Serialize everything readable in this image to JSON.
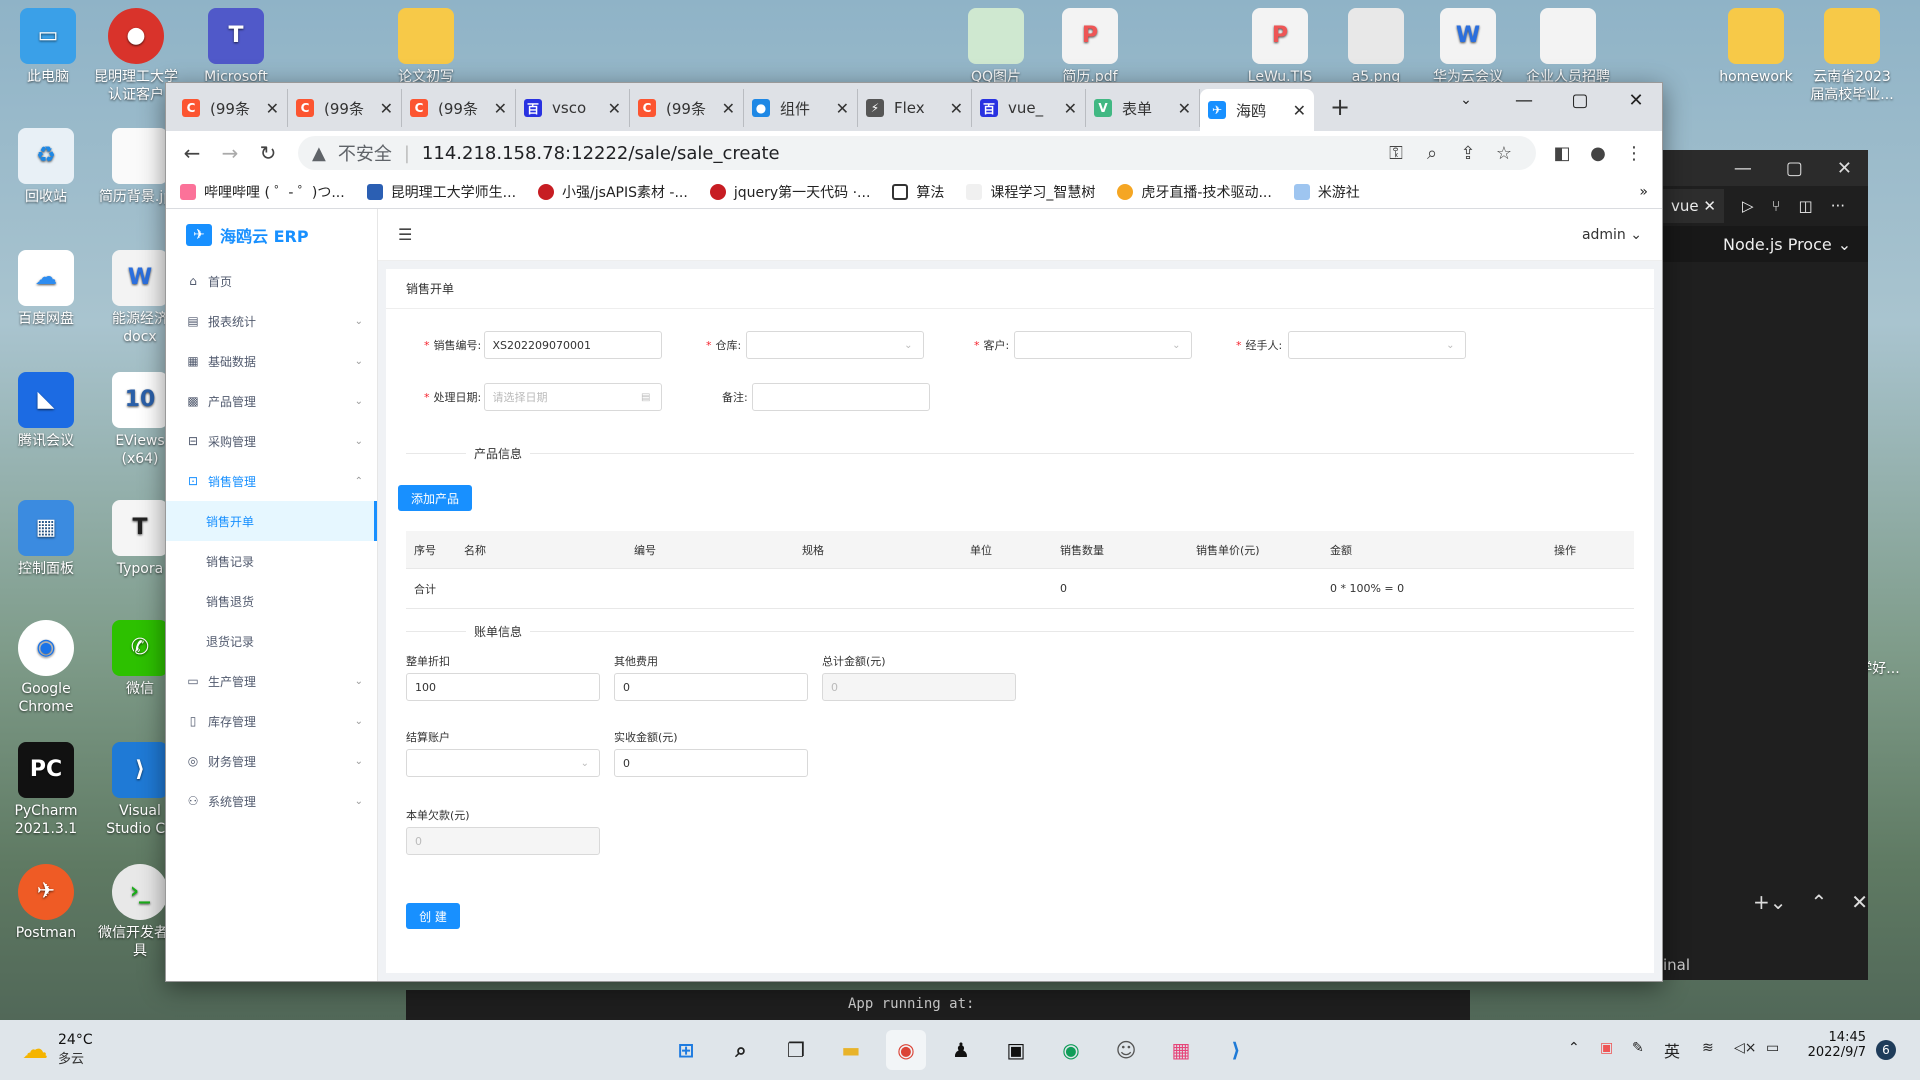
{
  "desktop": {
    "icons": [
      "此电脑",
      "昆明理工大学认证客户",
      "Microsoft",
      "论文初写",
      "QQ图片",
      "简历.pdf",
      "LeWu.TIS",
      "a5.png",
      "华为云会议",
      "企业人员招聘",
      "homework",
      "云南省2023届高校毕业...",
      "回收站",
      "简历背景.jpg",
      "百度网盘",
      "能源经济docx",
      "腾讯会议",
      "EViews (x64)",
      "控制面板",
      "Typora",
      "Google Chrome",
      "微信",
      "PyCharm 2021.3.1",
      "Visual Studio Co",
      "Postman",
      "微信开发者工具",
      "济学好..."
    ]
  },
  "browser": {
    "tabs": [
      {
        "title": "(99条",
        "color": "#fc5531",
        "glyph": "C"
      },
      {
        "title": "(99条",
        "color": "#fc5531",
        "glyph": "C"
      },
      {
        "title": "(99条",
        "color": "#fc5531",
        "glyph": "C"
      },
      {
        "title": "vsco",
        "color": "#2932e1",
        "glyph": "百"
      },
      {
        "title": "(99条",
        "color": "#fc5531",
        "glyph": "C"
      },
      {
        "title": "组件",
        "color": "#1e88e5",
        "glyph": "●"
      },
      {
        "title": "Flex",
        "color": "#555555",
        "glyph": "⚡"
      },
      {
        "title": "vue_",
        "color": "#2932e1",
        "glyph": "百"
      },
      {
        "title": "表单",
        "color": "#41b883",
        "glyph": "V"
      },
      {
        "title": "海鸥",
        "color": "#1890ff",
        "glyph": "✈"
      }
    ],
    "new_tab": "+",
    "security_label": "不安全",
    "url": "114.218.158.78:12222/sale/sale_create",
    "bookmarks": [
      "哔哩哔哩 ( ゜- ゜)つ...",
      "昆明理工大学师生...",
      "小强/jsAPIS素材 -...",
      "jquery第一天代码 ·...",
      "算法",
      "课程学习_智慧树",
      "虎牙直播-技术驱动...",
      "米游社"
    ],
    "bookmarks_more": "»"
  },
  "app": {
    "brand": "海鸥云 ERP",
    "user": "admin",
    "menu": [
      {
        "label": "首页",
        "icon": "⌂"
      },
      {
        "label": "报表统计",
        "icon": "▤"
      },
      {
        "label": "基础数据",
        "icon": "▦"
      },
      {
        "label": "产品管理",
        "icon": "▩"
      },
      {
        "label": "采购管理",
        "icon": "⊟"
      },
      {
        "label": "销售管理",
        "icon": "⊡"
      }
    ],
    "submenu": [
      "销售开单",
      "销售记录",
      "销售退货",
      "退货记录"
    ],
    "menu_after": [
      {
        "label": "生产管理",
        "icon": "▭"
      },
      {
        "label": "库存管理",
        "icon": "▯"
      },
      {
        "label": "财务管理",
        "icon": "◎"
      },
      {
        "label": "系统管理",
        "icon": "⚇"
      }
    ],
    "page_title": "销售开单",
    "form": {
      "sale_no_label": "销售编号:",
      "sale_no": "XS202209070001",
      "warehouse_label": "仓库:",
      "customer_label": "客户:",
      "handler_label": "经手人:",
      "date_label": "处理日期:",
      "date_placeholder": "请选择日期",
      "note_label": "备注:"
    },
    "product_section": "产品信息",
    "add_product": "添加产品",
    "table": {
      "headers": [
        "序号",
        "名称",
        "编号",
        "规格",
        "单位",
        "销售数量",
        "销售单价(元)",
        "金额",
        "操作"
      ],
      "total_label": "合计",
      "total_qty": "0",
      "total_amount": "0 * 100% = 0"
    },
    "bill_section": "账单信息",
    "bill": {
      "discount_label": "整单折扣",
      "discount": "100",
      "other_fee_label": "其他费用",
      "other_fee": "0",
      "total_label": "总计金额(元)",
      "total": "0",
      "account_label": "结算账户",
      "received_label": "实收金额(元)",
      "received": "0",
      "debt_label": "本单欠款(元)",
      "debt": "0"
    },
    "create_button": "创 建"
  },
  "vscode": {
    "tab": "vue",
    "panel": "Node.js Proce",
    "terminal": "App running at:",
    "term_label": "inal"
  },
  "taskbar": {
    "weather_temp": "24°C",
    "weather_desc": "多云",
    "ime": "英",
    "time": "14:45",
    "date": "2022/9/7",
    "badge": "6"
  }
}
